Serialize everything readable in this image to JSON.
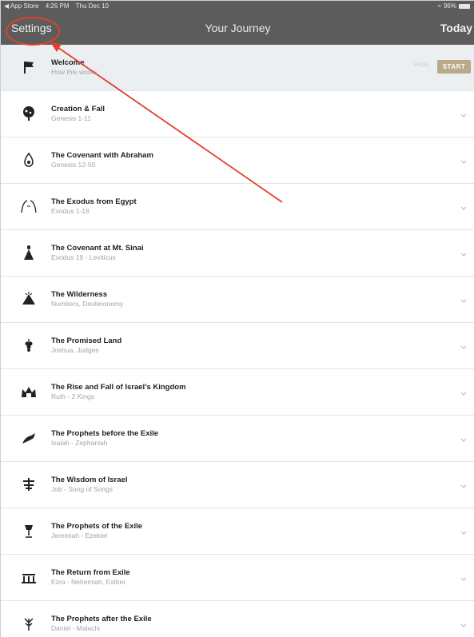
{
  "status_bar": {
    "back_app": "◀ App Store",
    "time": "4:26 PM",
    "date": "Thu Dec 10",
    "battery": "96%"
  },
  "nav": {
    "left": "Settings",
    "title": "Your Journey",
    "right": "Today"
  },
  "welcome": {
    "title": "Welcome",
    "subtitle": "How this works",
    "hide_label": "HIDE",
    "start_label": "START"
  },
  "items": [
    {
      "title": "Creation & Fall",
      "subtitle": "Genesis 1-11",
      "icon": "tree-icon"
    },
    {
      "title": "The Covenant with Abraham",
      "subtitle": "Genesis 12-50",
      "icon": "star-icon"
    },
    {
      "title": "The Exodus from Egypt",
      "subtitle": "Exodus 1-18",
      "icon": "sea-icon"
    },
    {
      "title": "The Covenant at Mt. Sinai",
      "subtitle": "Exodus 19 - Leviticus",
      "icon": "tablets-icon"
    },
    {
      "title": "The Wilderness",
      "subtitle": "Numbers, Deuteronomy",
      "icon": "tent-icon"
    },
    {
      "title": "The Promised Land",
      "subtitle": "Joshua, Judges",
      "icon": "grapes-icon"
    },
    {
      "title": "The Rise and Fall of Israel's Kingdom",
      "subtitle": "Ruth - 2 Kings",
      "icon": "crown-icon"
    },
    {
      "title": "The Prophets before the Exile",
      "subtitle": "Isaiah - Zephaniah",
      "icon": "prophet-icon"
    },
    {
      "title": "The Wisdom of Israel",
      "subtitle": "Job - Song of Songs",
      "icon": "lamp-icon"
    },
    {
      "title": "The Prophets of the Exile",
      "subtitle": "Jeremiah - Ezekiel",
      "icon": "cup-icon"
    },
    {
      "title": "The Return from Exile",
      "subtitle": "Ezra - Nehemiah, Esther",
      "icon": "temple-icon"
    },
    {
      "title": "The Prophets after the Exile",
      "subtitle": "Daniel - Malachi",
      "icon": "branch-icon"
    }
  ],
  "colors": {
    "nav_bg": "#5c5c5c",
    "start_btn": "#b8a98a",
    "welcome_bg": "#eceff1",
    "annotation": "#e0412c"
  }
}
